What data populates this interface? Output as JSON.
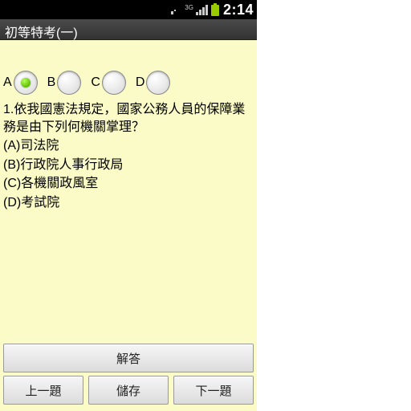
{
  "status": {
    "network_label": "3G",
    "clock": "2:14"
  },
  "app_title": "初等特考(一)",
  "options": {
    "a": {
      "label": "A",
      "selected": true
    },
    "b": {
      "label": "B",
      "selected": false
    },
    "c": {
      "label": "C",
      "selected": false
    },
    "d": {
      "label": "D",
      "selected": false
    }
  },
  "question": {
    "stem": "1.依我國憲法規定，國家公務人員的保障業務是由下列何機關掌理？",
    "choice_a": "(A)司法院",
    "choice_b": "(B)行政院人事行政局",
    "choice_c": "(C)各機關政風室",
    "choice_d": "(D)考試院"
  },
  "buttons": {
    "answer": "解答",
    "prev": "上一題",
    "save": "儲存",
    "next": "下一題"
  }
}
